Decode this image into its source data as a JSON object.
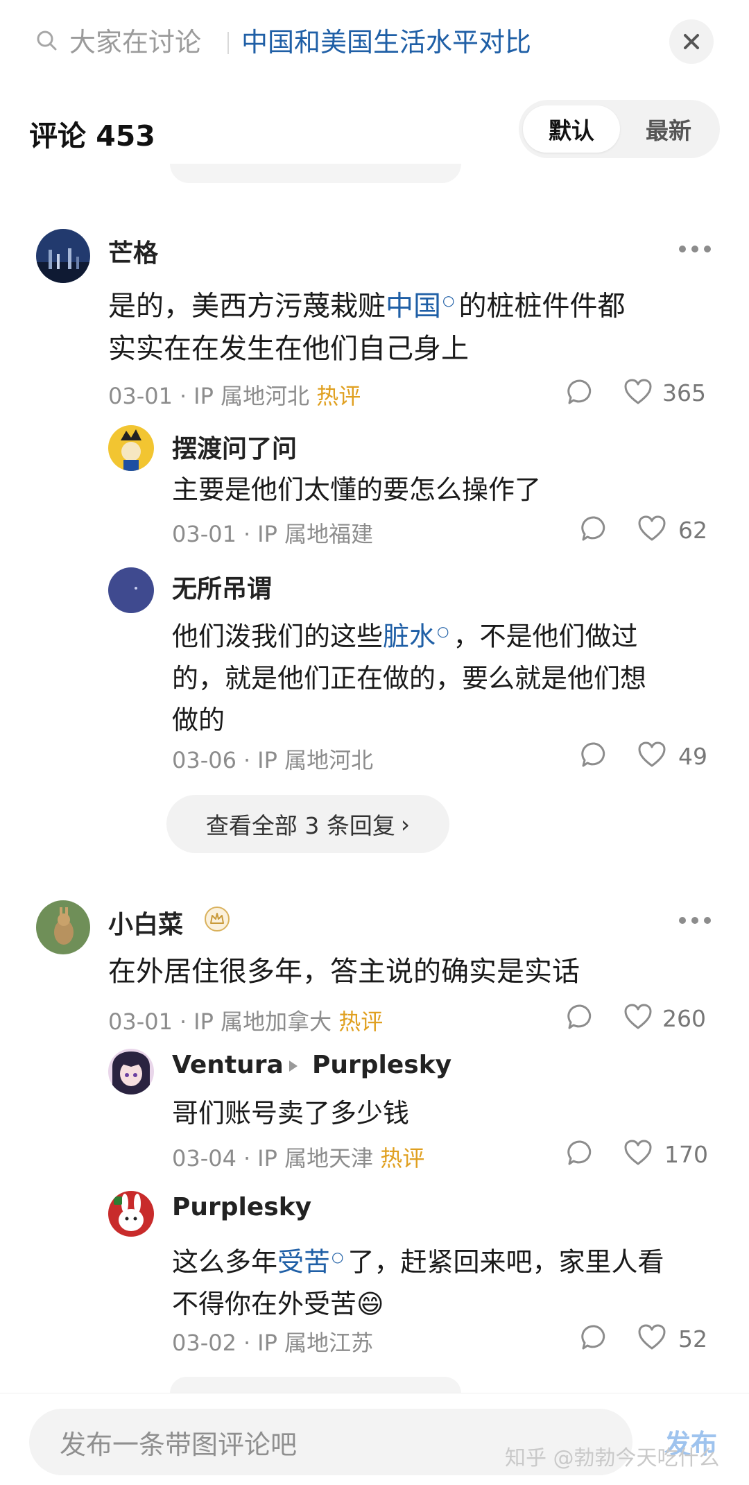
{
  "topbar": {
    "search_prefix": "大家在讨论",
    "topic": "中国和美国生活水平对比"
  },
  "header": {
    "title": "评论 453",
    "sort_default": "默认",
    "sort_latest": "最新"
  },
  "comments": [
    {
      "name": "芒格",
      "text_a": "是的，美西方污蔑栽赃",
      "link": "中国",
      "text_b": "的桩桩件件都",
      "text_c": "实实在在发生在他们自己身上",
      "date": "03-01",
      "ip": "IP 属地河北",
      "hot": "热评",
      "likes": "365",
      "replies": [
        {
          "name": "摆渡问了问",
          "text": "主要是他们太懂的要怎么操作了",
          "date": "03-01",
          "ip": "IP 属地福建",
          "likes": "62"
        },
        {
          "name": "无所吊谓",
          "text_a": "他们泼我们的这些",
          "link": "脏水",
          "text_b": "，不是他们做过",
          "text_c": "的，就是他们正在做的，要么就是他们想",
          "text_d": "做的",
          "date": "03-06",
          "ip": "IP 属地河北",
          "likes": "49"
        }
      ],
      "view_all": "查看全部 3 条回复"
    },
    {
      "name": "小白菜",
      "text": "在外居住很多年，答主说的确实是实话",
      "date": "03-01",
      "ip": "IP 属地加拿大",
      "hot": "热评",
      "likes": "260",
      "replies": [
        {
          "name": "Ventura",
          "reply_to": "Purplesky",
          "text": "哥们账号卖了多少钱",
          "date": "03-04",
          "ip": "IP 属地天津",
          "hot": "热评",
          "likes": "170"
        },
        {
          "name": "Purplesky",
          "text_a": "这么多年",
          "link": "受苦",
          "text_b": "了，赶紧回来吧，家里人看",
          "text_c": "不得你在外受苦",
          "emoji": "😄",
          "date": "03-02",
          "ip": "IP 属地江苏",
          "likes": "52"
        }
      ]
    }
  ],
  "bottombar": {
    "placeholder": "发布一条带图评论吧",
    "publish": "发布",
    "watermark": "知乎 @勃勃今天吃什么"
  }
}
